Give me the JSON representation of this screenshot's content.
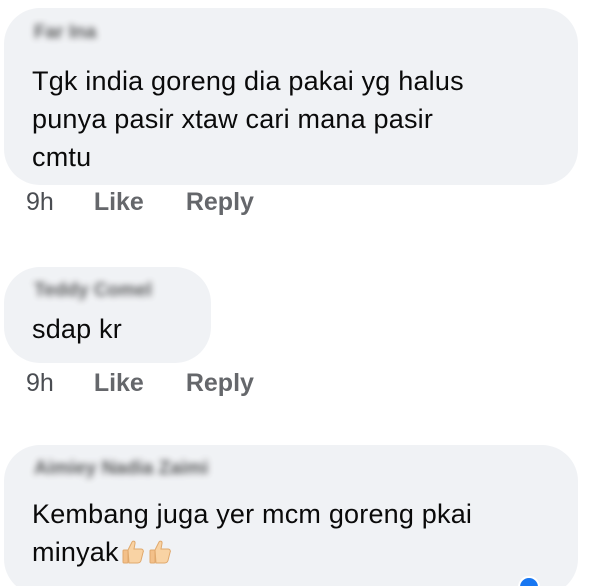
{
  "comments": [
    {
      "author": "Far Ina",
      "text": "Tgk india goreng dia pakai yg halus\npunya pasir xtaw cari mana pasir\ncmtu",
      "time": "9h",
      "like_label": "Like",
      "reply_label": "Reply"
    },
    {
      "author": "Teddy Comel",
      "text": "sdap kr",
      "time": "9h",
      "like_label": "Like",
      "reply_label": "Reply"
    },
    {
      "author": "Aimiey Nadia Zaimi",
      "text": "Kembang juga yer mcm goreng pkai\nminyak",
      "emoji": [
        "thumbs-up-icon",
        "thumbs-up-icon"
      ],
      "reaction_icon": "like-reaction-icon"
    }
  ],
  "colors": {
    "bubble": "#f0f2f5",
    "meta_text": "#65676b",
    "reaction": "#1877f2"
  }
}
